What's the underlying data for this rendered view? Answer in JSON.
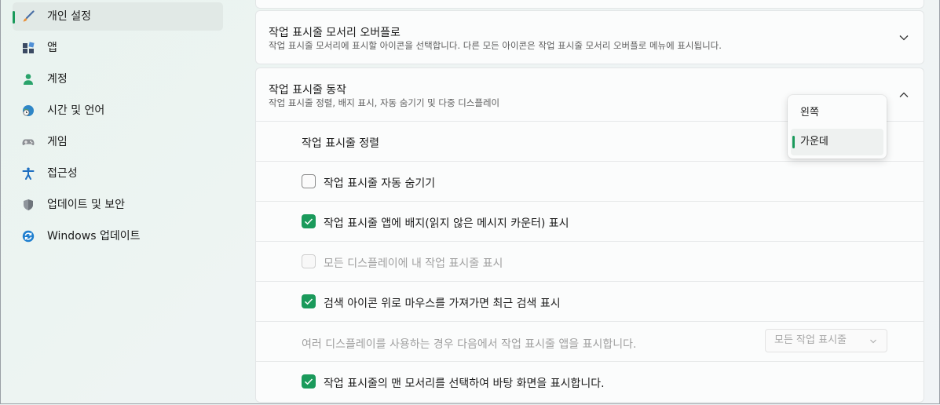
{
  "sidebar": {
    "items": [
      {
        "label": "개인 설정",
        "icon": "paintbrush-icon"
      },
      {
        "label": "앱",
        "icon": "apps-icon"
      },
      {
        "label": "계정",
        "icon": "person-icon"
      },
      {
        "label": "시간 및 언어",
        "icon": "globe-clock-icon"
      },
      {
        "label": "게임",
        "icon": "gamepad-icon"
      },
      {
        "label": "접근성",
        "icon": "accessibility-icon"
      },
      {
        "label": "업데이트 및 보안",
        "icon": "shield-icon"
      },
      {
        "label": "Windows 업데이트",
        "icon": "windows-update-icon"
      }
    ],
    "active_index": 0
  },
  "overflow_card": {
    "title": "작업 표시줄 모서리 오버플로",
    "description": "작업 표시줄 모서리에 표시할 아이콘을 선택합니다. 다른 모든 아이콘은 작업 표시줄 모서리 오버플로 메뉴에 표시됩니다."
  },
  "behavior_card": {
    "title": "작업 표시줄 동작",
    "description": "작업 표시줄 정렬, 배지 표시, 자동 숨기기 및 다중 디스플레이",
    "alignment_label": "작업 표시줄 정렬",
    "alignment_options": [
      "왼쪽",
      "가운데"
    ],
    "alignment_selected": "가운데",
    "options": [
      {
        "label": "작업 표시줄 자동 숨기기",
        "checked": false,
        "disabled": false
      },
      {
        "label": "작업 표시줄 앱에 배지(읽지 않은 메시지 카운터) 표시",
        "checked": true,
        "disabled": false
      },
      {
        "label": "모든 디스플레이에 내 작업 표시줄 표시",
        "checked": false,
        "disabled": true
      },
      {
        "label": "검색 아이콘 위로 마우스를 가져가면 최근 검색 표시",
        "checked": true,
        "disabled": false
      }
    ],
    "multi_display_label": "여러 디스플레이를 사용하는 경우 다음에서 작업 표시줄 앱을 표시합니다.",
    "multi_display_value": "모든 작업 표시줄",
    "corner_desktop_label": "작업 표시줄의 맨 모서리를 선택하여 바탕 화면을 표시합니다.",
    "corner_desktop_checked": true
  },
  "colors": {
    "accent": "#1a9a5b"
  }
}
